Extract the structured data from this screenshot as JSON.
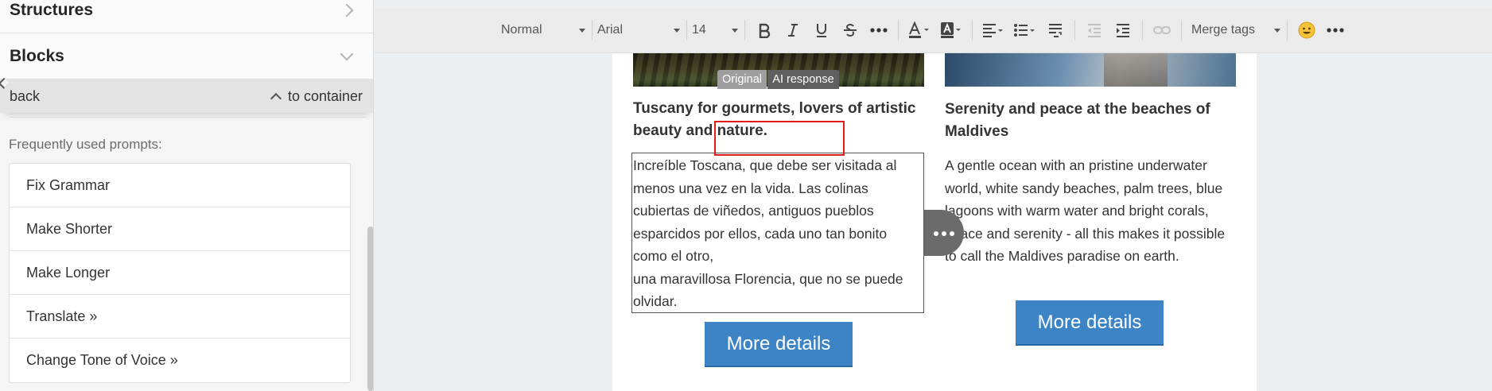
{
  "sidebar": {
    "structures_label": "Structures",
    "blocks_label": "Blocks",
    "back_label": "back",
    "to_container_label": "to container",
    "prompts_heading": "Frequently used prompts:",
    "prompts": [
      "Fix Grammar",
      "Make Shorter",
      "Make Longer",
      "Translate »",
      "Change Tone of Voice »"
    ]
  },
  "toolbar": {
    "format_value": "Normal",
    "font_value": "Arial",
    "size_value": "14",
    "merge_tags_label": "Merge tags"
  },
  "email": {
    "left_heading": "Tuscany for gourmets, lovers of artistic beauty and nature.",
    "left_ai_text_1": "Increíble Toscana, que debe ser visitada al menos una vez en la vida. Las colinas cubiertas de viñedos, antiguos pueblos esparcidos por ellos, cada uno tan bonito como el otro,",
    "left_ai_text_2": "una maravillosa Florencia, que no se puede olvidar.",
    "tab_original": "Original",
    "tab_ai_response": "AI response",
    "left_button": "More details",
    "right_heading": "Serenity and peace at the beaches of Maldives",
    "right_text": "A gentle ocean with an pristine underwater world, white sandy beaches, palm trees, blue lagoons with warm water and bright corals, peace and serenity - all this makes it possible to call the Maldives paradise on earth.",
    "right_button": "More details"
  }
}
